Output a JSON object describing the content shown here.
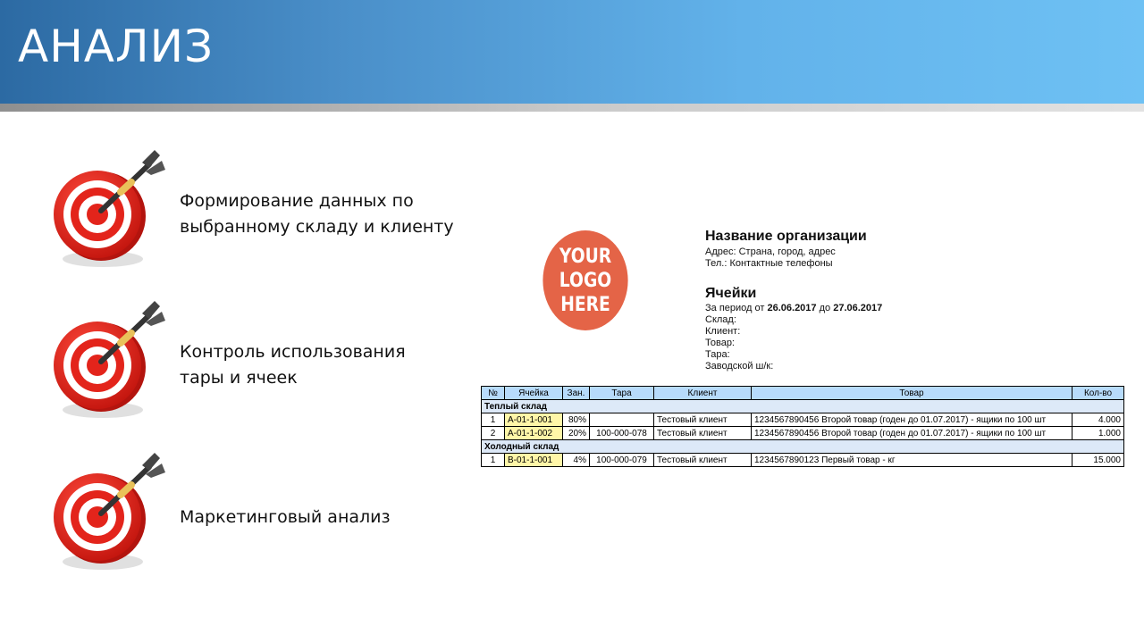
{
  "header": {
    "title": "АНАЛИЗ"
  },
  "goals": [
    {
      "text": "Формирование данных по\nвыбранному складу и клиенту"
    },
    {
      "text": "Контроль использования\nтары и ячеек"
    },
    {
      "text": "Маркетинговый анализ"
    }
  ],
  "logo": {
    "line1": "YOUR",
    "line2": "LOGO",
    "line3": "HERE"
  },
  "organization": {
    "name": "Название организации",
    "address": "Адрес: Страна, город, адрес",
    "phone": "Тел.: Контактные телефоны"
  },
  "report": {
    "title": "Ячейки",
    "period_prefix": "За период от ",
    "date_from": "26.06.2017",
    "period_middle": " до ",
    "date_to": "27.06.2017",
    "warehouse": "Склад:",
    "client": "Клиент:",
    "product": "Товар:",
    "container": "Тара:",
    "barcode": "Заводской ш/к:"
  },
  "table": {
    "headers": [
      "№",
      "Ячейка",
      "Зан.",
      "Тара",
      "Клиент",
      "Товар",
      "Кол-во"
    ],
    "groups": [
      {
        "name": "Теплый склад",
        "rows": [
          [
            "1",
            "A-01-1-001",
            "80%",
            "",
            "Тестовый клиент",
            "1234567890456 Второй товар (годен до 01.07.2017) - ящики по 100 шт",
            "4.000"
          ],
          [
            "2",
            "A-01-1-002",
            "20%",
            "100-000-078",
            "Тестовый клиент",
            "1234567890456 Второй товар (годен до 01.07.2017) - ящики по 100 шт",
            "1.000"
          ]
        ]
      },
      {
        "name": "Холодный склад",
        "rows": [
          [
            "1",
            "B-01-1-001",
            "4%",
            "100-000-079",
            "Тестовый клиент",
            "1234567890123 Первый товар - кг",
            "15.000"
          ]
        ]
      }
    ]
  },
  "colors": {
    "header_start": "#2c6aa3",
    "header_end": "#6ec1f4",
    "logo_circle": "#e46447",
    "table_header": "#b7dbfb",
    "cell_highlight": "#fff6a8",
    "target_red": "#e3241b"
  },
  "icons": {
    "goal_icon": "target-with-dart-icon"
  }
}
